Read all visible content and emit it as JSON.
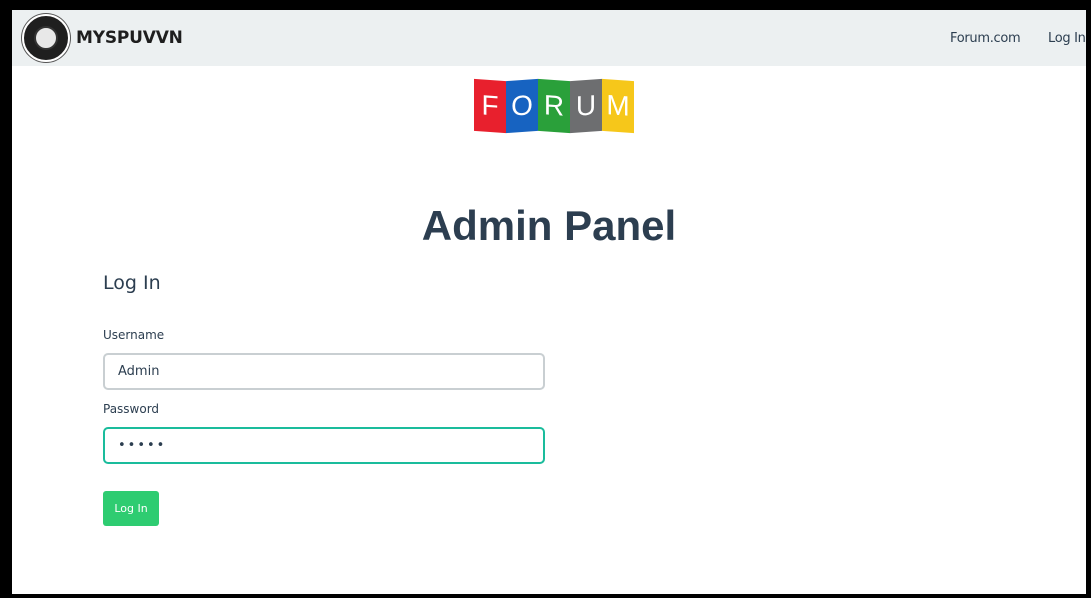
{
  "navbar": {
    "brand": "MYSPUVVN",
    "links": [
      "Forum.com",
      "Log In"
    ]
  },
  "logo_letters": [
    "F",
    "O",
    "R",
    "U",
    "M"
  ],
  "logo_colors": [
    "#e8202d",
    "#1763c1",
    "#2aa03a",
    "#6d6e70",
    "#f6c71a"
  ],
  "page": {
    "title": "Admin Panel",
    "section_title": "Log In"
  },
  "form": {
    "username_label": "Username",
    "username_value": "Admin",
    "password_label": "Password",
    "password_value": "•••••",
    "submit_label": "Log In"
  },
  "colors": {
    "primary": "#2c3e50",
    "success": "#2ecc71",
    "focus": "#1abc9c"
  }
}
